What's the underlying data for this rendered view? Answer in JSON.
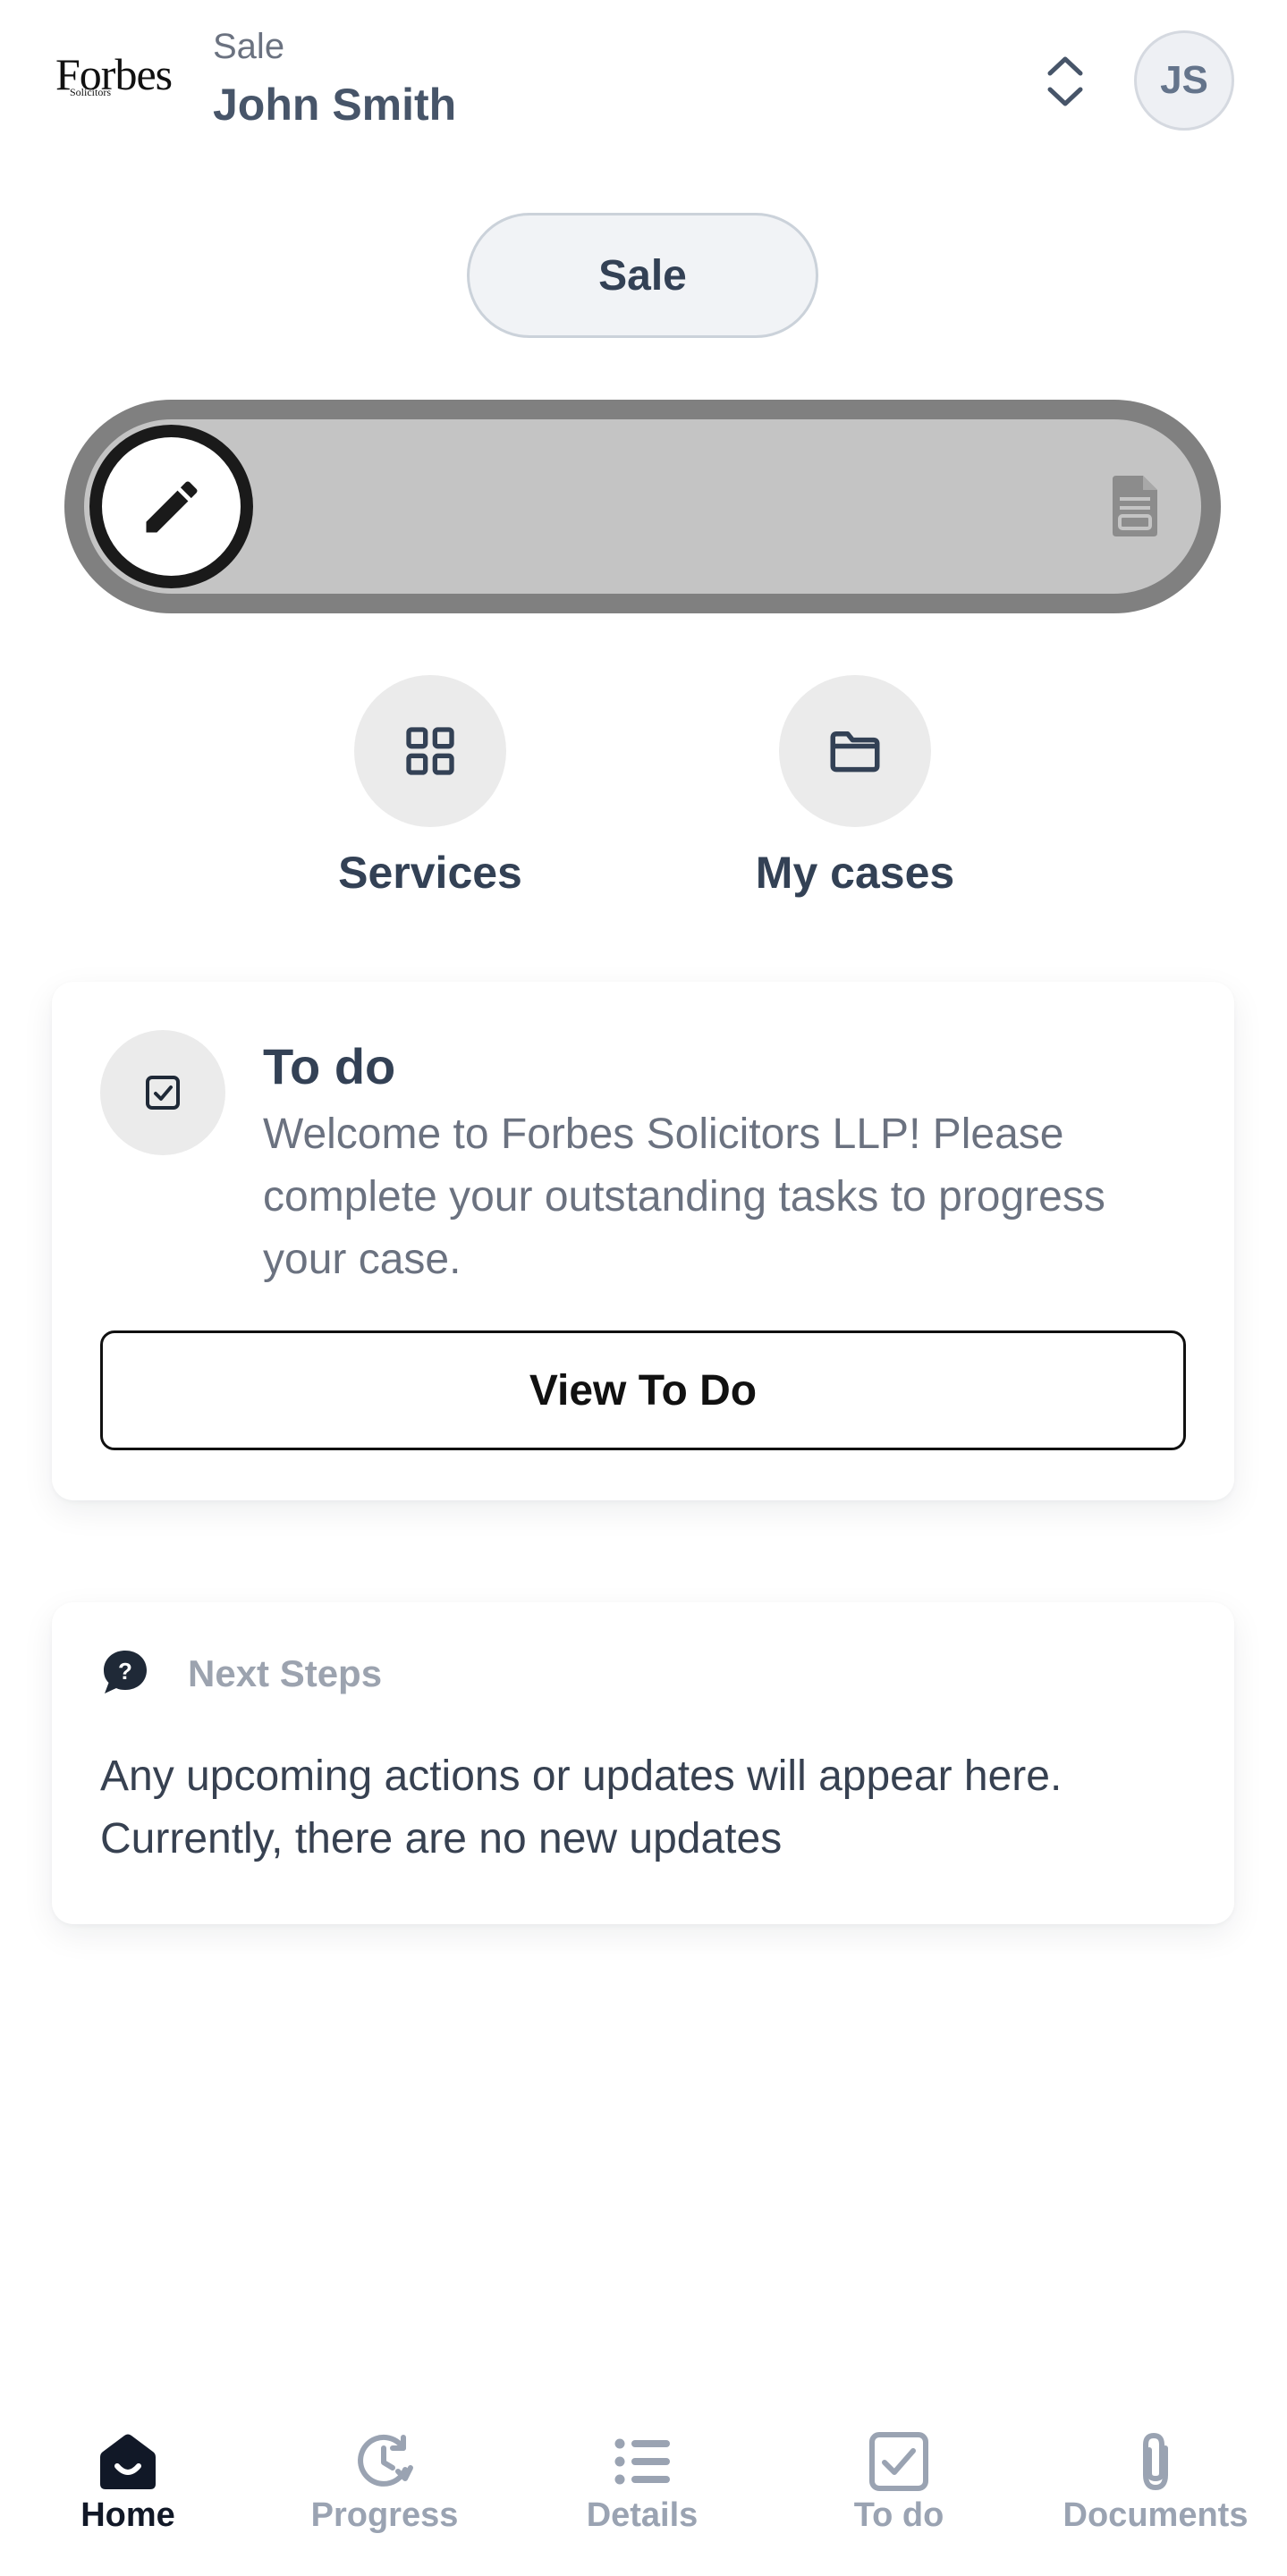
{
  "header": {
    "logo_text": "Forbes",
    "logo_sub": "Solicitors",
    "case_type": "Sale",
    "client_name": "John Smith",
    "avatar_initials": "JS"
  },
  "sale_pill": {
    "label": "Sale"
  },
  "progress": {
    "value": 0
  },
  "quick_actions": [
    {
      "label": "Services",
      "icon": "grid-icon"
    },
    {
      "label": "My cases",
      "icon": "folder-icon"
    }
  ],
  "todo_card": {
    "title": "To do",
    "text": "Welcome to Forbes Solicitors LLP! Please complete your outstanding tasks to progress your case.",
    "button_label": "View To Do"
  },
  "next_steps": {
    "title": "Next Steps",
    "text": "Any upcoming actions or updates will appear here. Currently, there are no new updates"
  },
  "bottom_nav": {
    "items": [
      {
        "label": "Home",
        "icon": "home-icon",
        "active": true
      },
      {
        "label": "Progress",
        "icon": "clock-icon",
        "active": false
      },
      {
        "label": "Details",
        "icon": "list-icon",
        "active": false
      },
      {
        "label": "To do",
        "icon": "checkbox-icon",
        "active": false
      },
      {
        "label": "Documents",
        "icon": "paperclip-icon",
        "active": false
      }
    ]
  },
  "colors": {
    "text_primary": "#334155",
    "text_muted": "#6b7280",
    "nav_inactive": "#9aa3b2",
    "nav_active": "#111827",
    "track_outer": "#808080",
    "track_inner": "#c4c4c4"
  }
}
